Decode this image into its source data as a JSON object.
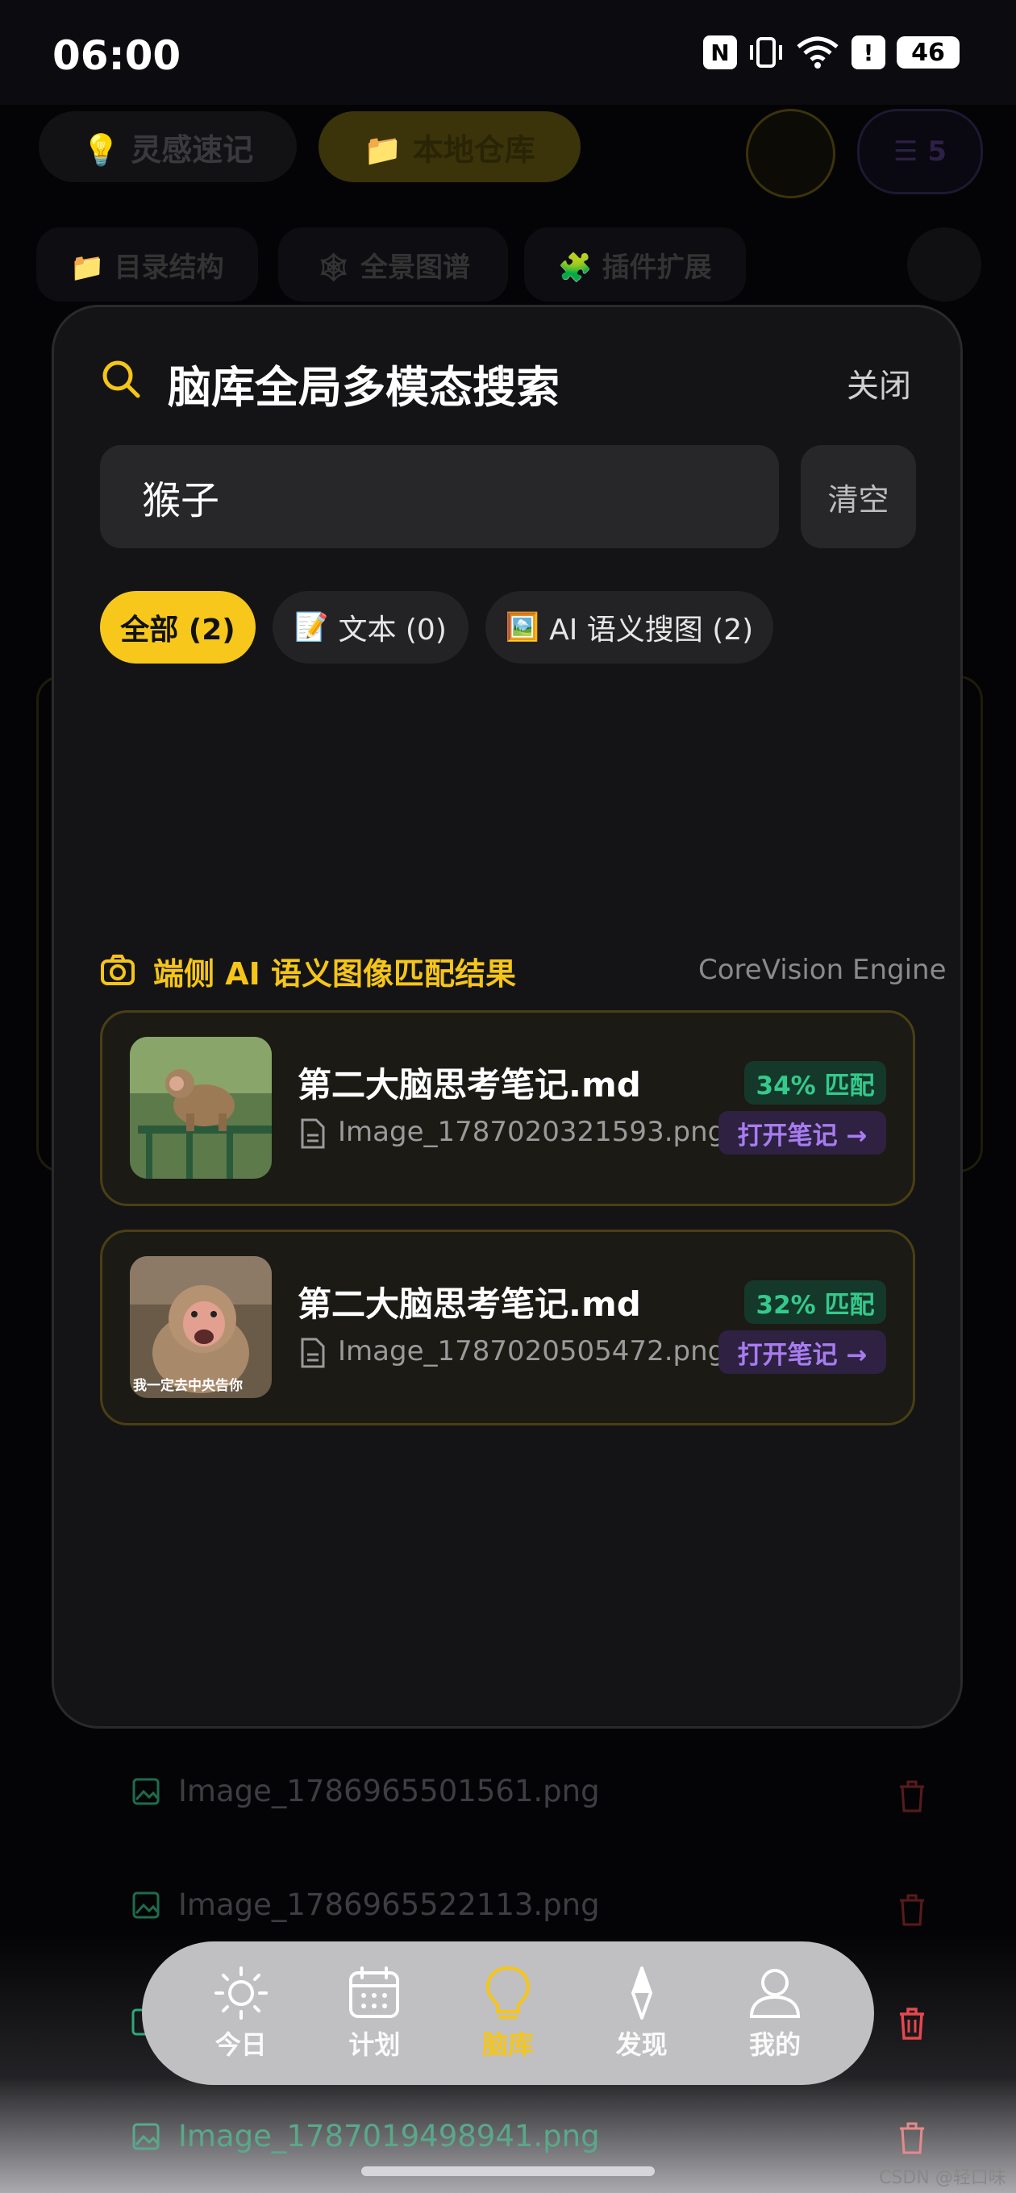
{
  "status_bar": {
    "time": "06:00",
    "battery": "46"
  },
  "background_app": {
    "top_tabs": [
      "💡 灵感速记",
      "📁 本地仓库"
    ],
    "filter_count": "5",
    "sub_tabs": [
      "📁 目录结构",
      "🕸 全景图谱",
      "🧩 插件扩展"
    ],
    "list_items": [
      "Image_1786965501561.png",
      "Image_1786965522113.png",
      "Image_1787019498941.png"
    ]
  },
  "search_modal": {
    "title": "脑库全局多模态搜索",
    "close_label": "关闭",
    "query": "猴子",
    "clear_label": "清空",
    "filter_tabs": [
      {
        "emoji": "",
        "label": "全部 (2)"
      },
      {
        "emoji": "📝",
        "label": "文本 (0)"
      },
      {
        "emoji": "🖼️",
        "label": "AI 语义搜图 (2)"
      }
    ],
    "section_title": "端侧 AI 语义图像匹配结果",
    "engine_label": "CoreVision Engine",
    "results": [
      {
        "note": "第二大脑思考笔记.md",
        "file": "Image_1787020321593.png",
        "match": "34% 匹配",
        "open_label": "打开笔记 →",
        "thumb_caption": ""
      },
      {
        "note": "第二大脑思考笔记.md",
        "file": "Image_1787020505472.png",
        "match": "32% 匹配",
        "open_label": "打开笔记 →",
        "thumb_caption": "我一定去中央告你"
      }
    ]
  },
  "bottom_nav": {
    "items": [
      {
        "label": "今日",
        "icon": "sun-icon"
      },
      {
        "label": "计划",
        "icon": "calendar-icon"
      },
      {
        "label": "脑库",
        "icon": "lightbulb-icon"
      },
      {
        "label": "发现",
        "icon": "compass-icon"
      },
      {
        "label": "我的",
        "icon": "user-icon"
      }
    ],
    "active_index": 2
  },
  "watermark": "CSDN @轻口味",
  "colors": {
    "accent": "#f5c518",
    "match_green": "#35c98c",
    "open_purple": "#a77cf0",
    "trash_red": "#e5484d"
  }
}
